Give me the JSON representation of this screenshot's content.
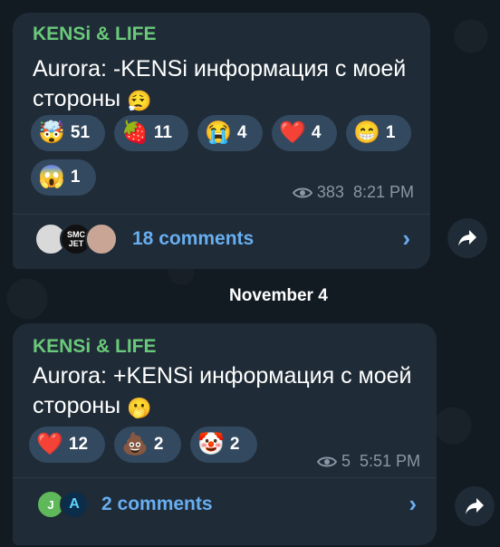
{
  "posts": [
    {
      "channel": "KENSi & LIFE",
      "text_line1": "Aurora: -KENSi информация с моей",
      "text_line2": "стороны",
      "text_emoji": "😮‍💨",
      "reactions": [
        {
          "emoji": "🤯",
          "count": "51"
        },
        {
          "emoji": "🍓",
          "count": "11"
        },
        {
          "emoji": "😭",
          "count": "4"
        },
        {
          "emoji": "❤️",
          "count": "4"
        },
        {
          "emoji": "😁",
          "count": "1"
        },
        {
          "emoji": "😱",
          "count": "1"
        }
      ],
      "views": "383",
      "time": "8:21 PM",
      "comments": "18 comments",
      "avatar_labels": [
        "",
        "SMC JET",
        ""
      ]
    },
    {
      "channel": "KENSi & LIFE",
      "text_line1": "Aurora: +KENSi информация с моей",
      "text_line2": "стороны",
      "text_emoji": "🫢",
      "reactions": [
        {
          "emoji": "❤️",
          "count": "12"
        },
        {
          "emoji": "💩",
          "count": "2"
        },
        {
          "emoji": "🤡",
          "count": "2"
        }
      ],
      "views": "5",
      "time": "5:51 PM",
      "comments": "2 comments",
      "avatar_labels": [
        "J",
        "A"
      ]
    }
  ],
  "date_separator": "November 4",
  "icons": {
    "views": "eye-icon",
    "chevron": "chevron-right-icon",
    "share": "share-arrow-icon"
  },
  "colors": {
    "accent_blue": "#68aef0",
    "channel_green": "#6ac97a",
    "bubble": "#1f2b36",
    "reaction_bg": "#33495f"
  }
}
